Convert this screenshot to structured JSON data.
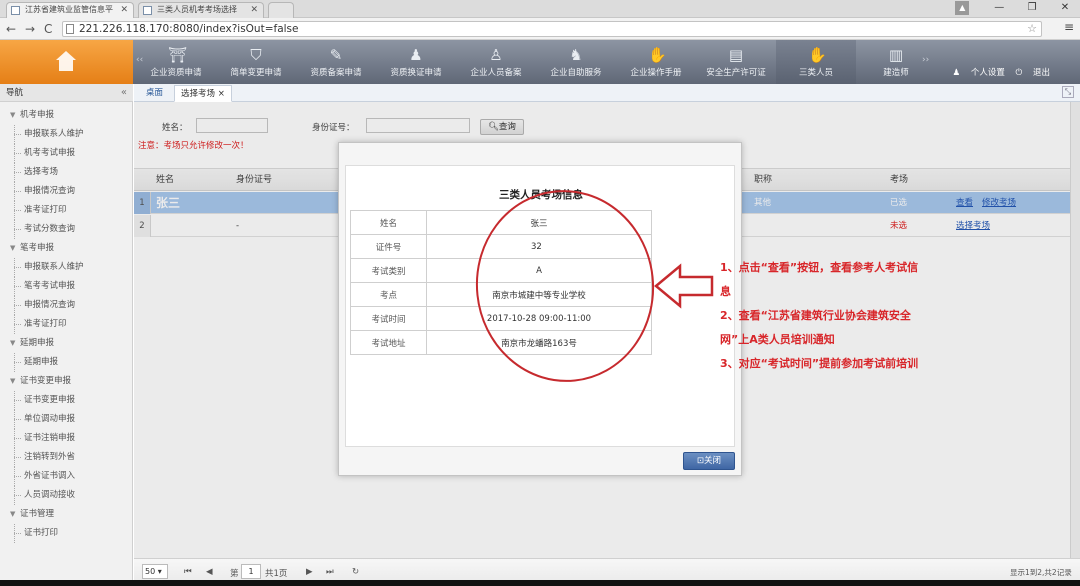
{
  "browser": {
    "tabs": [
      {
        "title": "江苏省建筑业监管信息平",
        "active": true
      },
      {
        "title": "三类人员机考考场选择",
        "active": false
      }
    ],
    "url": "221.226.118.170:8080/index?isOut=false",
    "window_controls": [
      "▲",
      "—",
      "❐",
      "✕"
    ]
  },
  "header": {
    "nav": [
      {
        "label": "企业资质申请",
        "icon": "crane-icon"
      },
      {
        "label": "简单变更申请",
        "icon": "shield-icon"
      },
      {
        "label": "资质备案申请",
        "icon": "worker-icon"
      },
      {
        "label": "资质换证申请",
        "icon": "person-icon"
      },
      {
        "label": "企业人员备案",
        "icon": "badge-icon"
      },
      {
        "label": "企业自助服务",
        "icon": "group-icon"
      },
      {
        "label": "企业操作手册",
        "icon": "handshake-icon"
      },
      {
        "label": "安全生产许可证",
        "icon": "document-icon"
      },
      {
        "label": "三类人员",
        "icon": "handshake-icon",
        "selected": true
      },
      {
        "label": "建造师",
        "icon": "book-icon"
      }
    ],
    "user_links": [
      "个人设置",
      "退出"
    ]
  },
  "sidebar": {
    "title": "导航",
    "collapse_glyph": "«",
    "groups": [
      {
        "label": "机考申报",
        "items": [
          "申报联系人维护",
          "机考考试申报",
          "选择考场",
          "申报情况查询",
          "准考证打印",
          "考试分数查询"
        ]
      },
      {
        "label": "笔考申报",
        "items": [
          "申报联系人维护",
          "笔考考试申报",
          "申报情况查询",
          "准考证打印"
        ]
      },
      {
        "label": "延期申报",
        "items": [
          "延期申报"
        ]
      },
      {
        "label": "证书变更申报",
        "items": [
          "证书变更申报",
          "单位调动申报",
          "证书注销申报",
          "注销转到外省",
          "外省证书调入",
          "人员调动接收"
        ]
      },
      {
        "label": "证书管理",
        "items": [
          "证书打印"
        ]
      }
    ]
  },
  "main_tabs": [
    {
      "label": "桌面",
      "active": false
    },
    {
      "label": "选择考场",
      "active": true
    }
  ],
  "search": {
    "name_label": "姓名：",
    "id_label": "身份证号：",
    "query_button": "查询",
    "notice": "注意：考场只允许修改一次！"
  },
  "grid": {
    "columns": [
      "姓名",
      "身份证号",
      "职称",
      "考场"
    ],
    "rows": [
      {
        "num": "1",
        "name": "张三",
        "id": "",
        "title": "其他",
        "status": "已选",
        "actions": [
          "查看",
          "修改考场"
        ],
        "selected": true
      },
      {
        "num": "2",
        "name": "",
        "id": "-",
        "title": "",
        "status": "未选",
        "actions": [
          "选择考场"
        ],
        "selected": false
      }
    ]
  },
  "pager": {
    "page_size": "50",
    "page_prefix": "第",
    "page_num": "1",
    "page_suffix": "共1页",
    "summary": "显示1到2,共2记录"
  },
  "modal": {
    "title": "三类人员考场信息",
    "rows": [
      {
        "key": "姓名",
        "value": "张三"
      },
      {
        "key": "证件号",
        "value": "32"
      },
      {
        "key": "考试类别",
        "value": "A"
      },
      {
        "key": "考点",
        "value": "南京市城建中等专业学校"
      },
      {
        "key": "考试时间",
        "value": "2017-10-28  09:00-11:00"
      },
      {
        "key": "考试地址",
        "value": "南京市龙蟠路163号"
      }
    ],
    "close_button": "关闭"
  },
  "annotation": {
    "lines": [
      "1、点击“查看”按钮，查看参考人考试信",
      "息",
      "2、查看“江苏省建筑行业协会建筑安全",
      "网”上A类人员培训通知",
      "3、对应“考试时间”提前参加考试前培训"
    ],
    "color": "#d8262a"
  },
  "colors": {
    "home_orange": "#f0901f",
    "header_gray": "#6d7584",
    "selected_row": "#a9c9ee",
    "link_blue": "#2458b8"
  }
}
